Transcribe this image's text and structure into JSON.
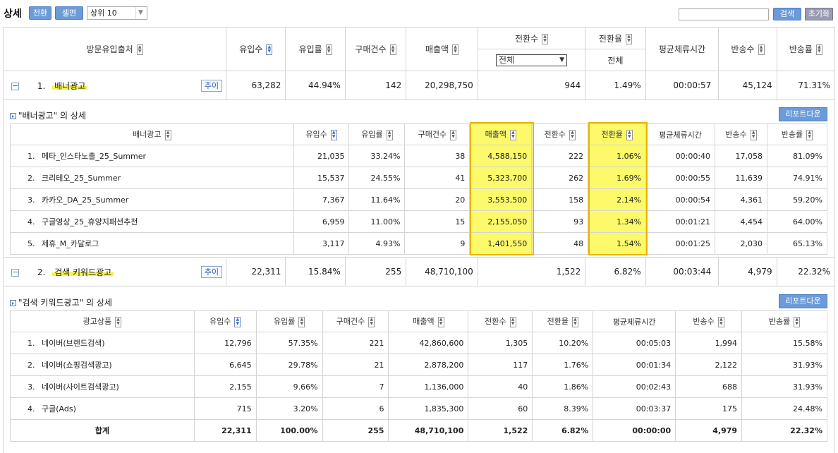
{
  "toolbar": {
    "title": "상세",
    "switch_label": "전환",
    "cell_edit_label": "셀편집",
    "top_select": "상위 10",
    "search_value": "",
    "search_label": "검색",
    "reset_label": "초기화"
  },
  "main": {
    "headers": {
      "source": "방문유입출처",
      "visits": "유입수",
      "visit_rate": "유입률",
      "purchases": "구매건수",
      "sales": "매출액",
      "conversions": "전환수",
      "conversion_filter": "전체",
      "conv_rate": "전환율",
      "conv_rate_sub": "전체",
      "avg_time": "평균체류시간",
      "bounces": "반송수",
      "bounce_rate": "반송률"
    },
    "rows": [
      {
        "index": "1.",
        "name": "배너광고",
        "trend": "추이",
        "visits": "63,282",
        "visit_rate": "44.94%",
        "purchases": "142",
        "sales": "20,298,750",
        "conversions": "944",
        "conv_rate": "1.49%",
        "avg_time": "00:00:57",
        "bounces": "45,124",
        "bounce_rate": "71.31%"
      },
      {
        "index": "2.",
        "name": "검색 키워드광고",
        "trend": "추이",
        "visits": "22,311",
        "visit_rate": "15.84%",
        "purchases": "255",
        "sales": "48,710,100",
        "conversions": "1,522",
        "conv_rate": "6.82%",
        "avg_time": "00:03:44",
        "bounces": "4,979",
        "bounce_rate": "22.32%"
      }
    ]
  },
  "banner_detail": {
    "title": "\"배너광고\" 의 상세",
    "report_label": "리포트다운",
    "headers": [
      "배너광고",
      "유입수",
      "유입률",
      "구매건수",
      "매출액",
      "전환수",
      "전환율",
      "평균체류시간",
      "반송수",
      "반송률"
    ],
    "rows": [
      {
        "index": "1.",
        "name": "메타_인스타노출_25_Summer",
        "visits": "21,035",
        "visit_rate": "33.24%",
        "purchases": "38",
        "sales": "4,588,150",
        "conversions": "222",
        "conv_rate": "1.06%",
        "avg_time": "00:00:40",
        "bounces": "17,058",
        "bounce_rate": "81.09%"
      },
      {
        "index": "2.",
        "name": "크리테오_25_Summer",
        "visits": "15,537",
        "visit_rate": "24.55%",
        "purchases": "41",
        "sales": "5,323,700",
        "conversions": "262",
        "conv_rate": "1.69%",
        "avg_time": "00:00:55",
        "bounces": "11,639",
        "bounce_rate": "74.91%"
      },
      {
        "index": "3.",
        "name": "카카오_DA_25_Summer",
        "visits": "7,367",
        "visit_rate": "11.64%",
        "purchases": "20",
        "sales": "3,553,500",
        "conversions": "158",
        "conv_rate": "2.14%",
        "avg_time": "00:00:54",
        "bounces": "4,361",
        "bounce_rate": "59.20%"
      },
      {
        "index": "4.",
        "name": "구글영상_25_휴양지패션추천",
        "visits": "6,959",
        "visit_rate": "11.00%",
        "purchases": "15",
        "sales": "2,155,050",
        "conversions": "93",
        "conv_rate": "1.34%",
        "avg_time": "00:01:21",
        "bounces": "4,454",
        "bounce_rate": "64.00%"
      },
      {
        "index": "5.",
        "name": "제휴_M_카달로그",
        "visits": "3,117",
        "visit_rate": "4.93%",
        "purchases": "9",
        "sales": "1,401,550",
        "conversions": "48",
        "conv_rate": "1.54%",
        "avg_time": "00:01:25",
        "bounces": "2,030",
        "bounce_rate": "65.13%"
      }
    ]
  },
  "search_detail": {
    "title": "\"검색 키워드광고\" 의 상세",
    "report_label": "리포트다운",
    "headers": [
      "광고상품",
      "유입수",
      "유입률",
      "구매건수",
      "매출액",
      "전환수",
      "전환율",
      "평균체류시간",
      "반송수",
      "반송률"
    ],
    "rows": [
      {
        "index": "1.",
        "name": "네이버(브랜드검색)",
        "visits": "12,796",
        "visit_rate": "57.35%",
        "purchases": "221",
        "sales": "42,860,600",
        "conversions": "1,305",
        "conv_rate": "10.20%",
        "avg_time": "00:05:03",
        "bounces": "1,994",
        "bounce_rate": "15.58%"
      },
      {
        "index": "2.",
        "name": "네이버(쇼핑검색광고)",
        "visits": "6,645",
        "visit_rate": "29.78%",
        "purchases": "21",
        "sales": "2,878,200",
        "conversions": "117",
        "conv_rate": "1.76%",
        "avg_time": "00:01:34",
        "bounces": "2,122",
        "bounce_rate": "31.93%"
      },
      {
        "index": "3.",
        "name": "네이버(사이트검색광고)",
        "visits": "2,155",
        "visit_rate": "9.66%",
        "purchases": "7",
        "sales": "1,136,000",
        "conversions": "40",
        "conv_rate": "1.86%",
        "avg_time": "00:02:43",
        "bounces": "688",
        "bounce_rate": "31.93%"
      },
      {
        "index": "4.",
        "name": "구글(Ads)",
        "visits": "715",
        "visit_rate": "3.20%",
        "purchases": "6",
        "sales": "1,835,300",
        "conversions": "60",
        "conv_rate": "8.39%",
        "avg_time": "00:03:37",
        "bounces": "175",
        "bounce_rate": "24.48%"
      }
    ],
    "total": {
      "name": "합계",
      "visits": "22,311",
      "visit_rate": "100.00%",
      "purchases": "255",
      "sales": "48,710,100",
      "conversions": "1,522",
      "conv_rate": "6.82%",
      "avg_time": "00:00:00",
      "bounces": "4,979",
      "bounce_rate": "22.32%"
    }
  }
}
